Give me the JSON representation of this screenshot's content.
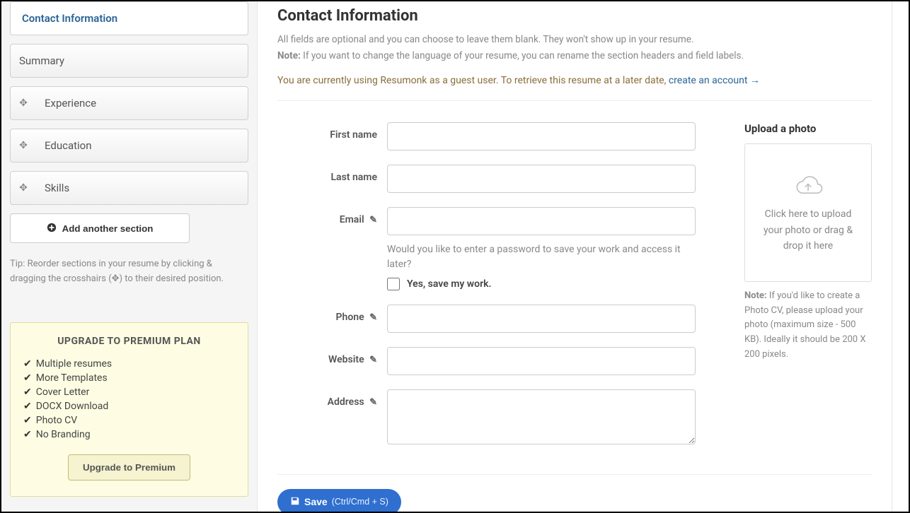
{
  "sidebar": {
    "sections": [
      {
        "label": "Contact Information",
        "active": true,
        "draggable": false
      },
      {
        "label": "Summary",
        "active": false,
        "draggable": false
      },
      {
        "label": "Experience",
        "active": false,
        "draggable": true
      },
      {
        "label": "Education",
        "active": false,
        "draggable": true
      },
      {
        "label": "Skills",
        "active": false,
        "draggable": true
      }
    ],
    "add_section": "Add another section",
    "tip": "Tip: Reorder sections in your resume by clicking & dragging the crosshairs (✥) to their desired position.",
    "upgrade": {
      "title": "UPGRADE TO PREMIUM PLAN",
      "features": [
        "Multiple resumes",
        "More Templates",
        "Cover Letter",
        "DOCX Download",
        "Photo CV",
        "No Branding"
      ],
      "button": "Upgrade to Premium"
    }
  },
  "main": {
    "title": "Contact Information",
    "hint_line1": "All fields are optional and you can choose to leave them blank. They won't show up in your resume.",
    "hint_note_label": "Note:",
    "hint_line2": " If you want to change the language of your resume, you can rename the section headers and field labels.",
    "guest_notice_prefix": "You are currently using Resumonk as a guest user. To retrieve this resume at a later date, ",
    "guest_notice_link": "create an account →",
    "fields": {
      "first_name": {
        "label": "First name",
        "value": ""
      },
      "last_name": {
        "label": "Last name",
        "value": ""
      },
      "email": {
        "label": "Email",
        "value": "",
        "editable": true
      },
      "password_prompt": "Would you like to enter a password to save your work and access it later?",
      "save_checkbox_label": "Yes, save my work.",
      "phone": {
        "label": "Phone",
        "value": "",
        "editable": true
      },
      "website": {
        "label": "Website",
        "value": "",
        "editable": true
      },
      "address": {
        "label": "Address",
        "value": "",
        "editable": true
      }
    },
    "photo": {
      "title": "Upload a photo",
      "dropzone_text": "Click here to upload your photo or drag & drop it here",
      "note_label": "Note:",
      "note_text": " If you'd like to create a Photo CV, please upload your photo (maximum size - 500 KB). Ideally it should be 200 X 200 pixels."
    },
    "save_button": "Save",
    "save_hint": "(Ctrl/Cmd + S)"
  }
}
